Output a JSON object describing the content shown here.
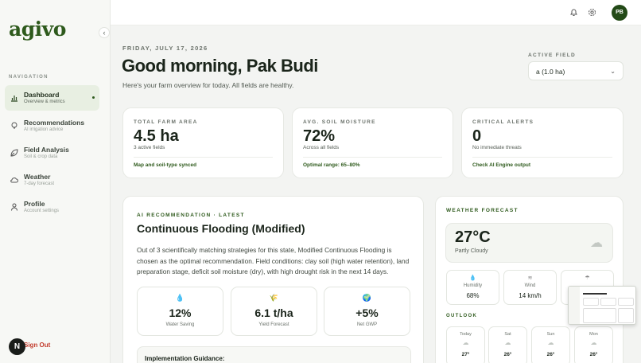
{
  "brand": {
    "logo": "agivo"
  },
  "sidebar": {
    "heading": "NAVIGATION",
    "items": [
      {
        "label": "Dashboard",
        "sub": "Overview & metrics"
      },
      {
        "label": "Recommendations",
        "sub": "AI irrigation advice"
      },
      {
        "label": "Field Analysis",
        "sub": "Soil & crop data"
      },
      {
        "label": "Weather",
        "sub": "7-day forecast"
      },
      {
        "label": "Profile",
        "sub": "Account settings"
      }
    ],
    "signout": "Sign Out",
    "bottom_avatar": "N"
  },
  "topbar": {
    "user_initials": "PB"
  },
  "header": {
    "date": "FRIDAY, JULY 17, 2026",
    "greeting": "Good morning, Pak Budi",
    "subline": "Here's your farm overview for today. All fields are healthy.",
    "field_label": "ACTIVE FIELD",
    "field_value": "a (1.0 ha)"
  },
  "stats": [
    {
      "label": "TOTAL FARM AREA",
      "value": "4.5 ha",
      "sub": "3 active fields",
      "foot": "Map and soil-type synced"
    },
    {
      "label": "AVG. SOIL MOISTURE",
      "value": "72%",
      "sub": "Across all fields",
      "foot": "Optimal range: 65–80%"
    },
    {
      "label": "CRITICAL ALERTS",
      "value": "0",
      "sub": "No immediate threats",
      "foot": "Check AI Engine output"
    }
  ],
  "recommendation": {
    "label": "AI RECOMMENDATION · LATEST",
    "title": "Continuous Flooding (Modified)",
    "body": "Out of 3 scientifically matching strategies for this state, Modified Continuous Flooding is chosen as the optimal recommendation. Field conditions: clay soil (high water retention), land preparation stage, deficit soil moisture (dry), with high drought risk in the next 14 days.",
    "metrics": [
      {
        "icon": "💧",
        "value": "12%",
        "label": "Water Saving"
      },
      {
        "icon": "🌾",
        "value": "6.1 t/ha",
        "label": "Yield Forecast"
      },
      {
        "icon": "🌍",
        "value": "+5%",
        "label": "Net GWP"
      }
    ],
    "guidance": "Implementation Guidance:"
  },
  "weather": {
    "label": "WEATHER FORECAST",
    "temp": "27°C",
    "condition": "Partly Cloudy",
    "details": [
      {
        "icon": "💧",
        "label": "Humidity",
        "value": "68%"
      },
      {
        "icon": "≋",
        "label": "Wind",
        "value": "14 km/h"
      },
      {
        "icon": "☂",
        "label": "",
        "value": ""
      }
    ],
    "outlook_label": "OUTLOOK",
    "days": [
      {
        "name": "Today",
        "temp": "27°"
      },
      {
        "name": "Sat",
        "temp": "26°"
      },
      {
        "name": "Sun",
        "temp": "26°"
      },
      {
        "name": "Mon",
        "temp": "26°"
      }
    ]
  }
}
